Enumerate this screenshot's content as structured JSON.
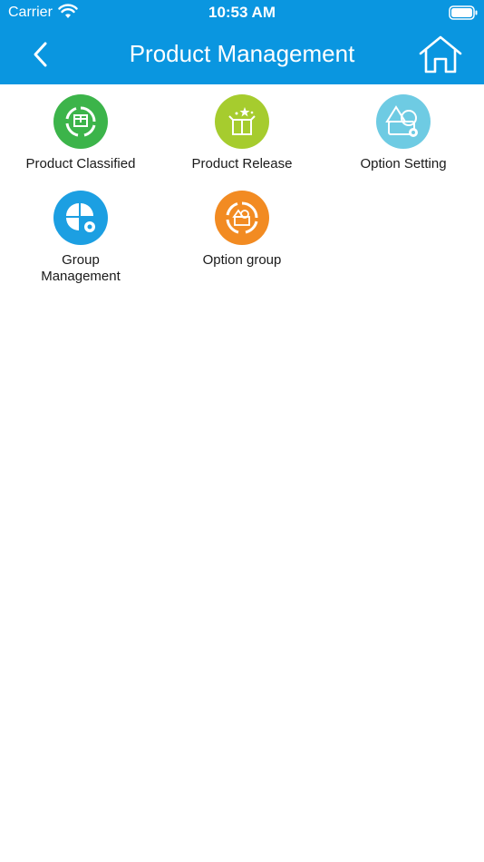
{
  "status_bar": {
    "carrier": "Carrier",
    "time": "10:53 AM"
  },
  "header": {
    "title": "Product Management",
    "back_icon": "chevron-left-icon",
    "home_icon": "home-icon",
    "background_color": "#0a96e0"
  },
  "tiles": [
    {
      "label": "Product Classified",
      "icon": "product-classified-icon",
      "color": "#3cb44a"
    },
    {
      "label": "Product Release",
      "icon": "product-release-icon",
      "color": "#a6cc2e"
    },
    {
      "label": "Option Setting",
      "icon": "option-setting-icon",
      "color": "#6ecbe3"
    },
    {
      "label": "Group\nManagement",
      "icon": "group-management-icon",
      "color": "#1c9fe2"
    },
    {
      "label": "Option group",
      "icon": "option-group-icon",
      "color": "#f28b22"
    }
  ]
}
